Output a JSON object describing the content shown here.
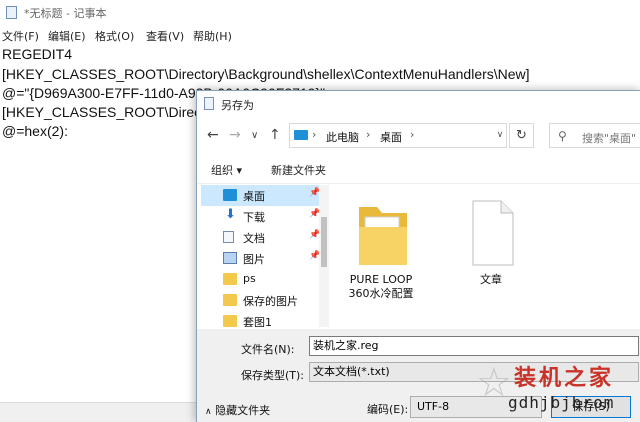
{
  "notepad": {
    "title": "*无标题 - 记事本",
    "menu": [
      "文件(F)",
      "编辑(E)",
      "格式(O)",
      "查看(V)",
      "帮助(H)"
    ],
    "lines": [
      "REGEDIT4",
      "[HKEY_CLASSES_ROOT\\Directory\\Background\\shellex\\ContextMenuHandlers\\New]",
      "@=\"{D969A300-E7FF-11d0-A93B-00A0C90F2719}\"",
      "[HKEY_CLASSES_ROOT\\Directory\\Background\\shell\\New]",
      "@=hex(2):"
    ]
  },
  "dialog": {
    "title": "另存为",
    "address": {
      "crumbs": [
        "此电脑",
        "桌面"
      ]
    },
    "search_placeholder": "搜索\"桌面\"",
    "toolbar": {
      "organize": "组织 ▾",
      "new_folder": "新建文件夹"
    },
    "nav_items": [
      {
        "label": "桌面",
        "icon": "desktop-icon",
        "pinned": true,
        "selected": true
      },
      {
        "label": "下载",
        "icon": "download-icon",
        "pinned": true
      },
      {
        "label": "文档",
        "icon": "document-icon",
        "pinned": true
      },
      {
        "label": "图片",
        "icon": "picture-icon",
        "pinned": true
      },
      {
        "label": "ps",
        "icon": "folder-icon"
      },
      {
        "label": "保存的图片",
        "icon": "folder-icon"
      },
      {
        "label": "套图1",
        "icon": "folder-icon"
      }
    ],
    "files": [
      {
        "name_line1": "PURE LOOP",
        "name_line2": "360水冷配置",
        "icon": "folder-icon"
      },
      {
        "name_line1": "文章",
        "name_line2": "",
        "icon": "file-icon"
      }
    ],
    "filename_label": "文件名(N):",
    "filename_value": "装机之家.reg",
    "filetype_label": "保存类型(T):",
    "filetype_value": "文本文档(*.txt)",
    "hide_folders": "隐藏文件夹",
    "encoding_label": "编码(E):",
    "encoding_value": "UTF-8",
    "save_button": "保存(S)"
  },
  "watermark": {
    "main": "装机之家",
    "sub": "gdhjbjbrom"
  },
  "colors": {
    "accent": "#0078d7",
    "selection": "#cce8ff",
    "watermark_red": "#c83228"
  }
}
